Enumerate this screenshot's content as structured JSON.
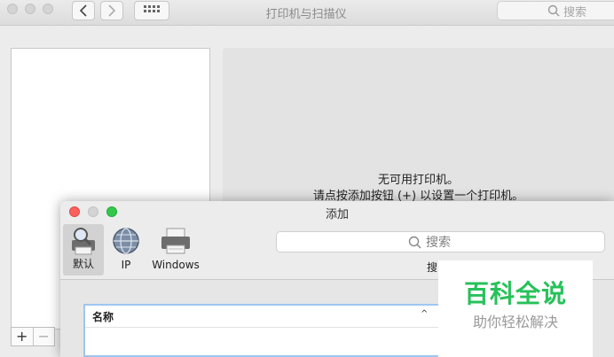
{
  "main_window": {
    "title": "打印机与扫描仪",
    "search_placeholder": "搜索",
    "empty_title": "无可用打印机。",
    "empty_hint": "请点按添加按钮 (+) 以设置一个打印机。",
    "add_label": "+",
    "remove_label": "−"
  },
  "add_dialog": {
    "title": "添加",
    "toolbar": [
      {
        "label": "默认",
        "icon": "default-printer-icon",
        "selected": true
      },
      {
        "label": "IP",
        "icon": "globe-icon",
        "selected": false
      },
      {
        "label": "Windows",
        "icon": "windows-printer-icon",
        "selected": false
      }
    ],
    "search_placeholder": "搜索",
    "search_label": "搜",
    "table": {
      "column_name": "名称",
      "sort_indicator": "^"
    }
  },
  "watermark": {
    "main": "百科全说",
    "sub": "助你轻松解决"
  },
  "colors": {
    "accent_blue": "#9ec6f1",
    "watermark_green": "#27c15a",
    "close_red": "#fc605c",
    "zoom_green": "#34c84a"
  }
}
